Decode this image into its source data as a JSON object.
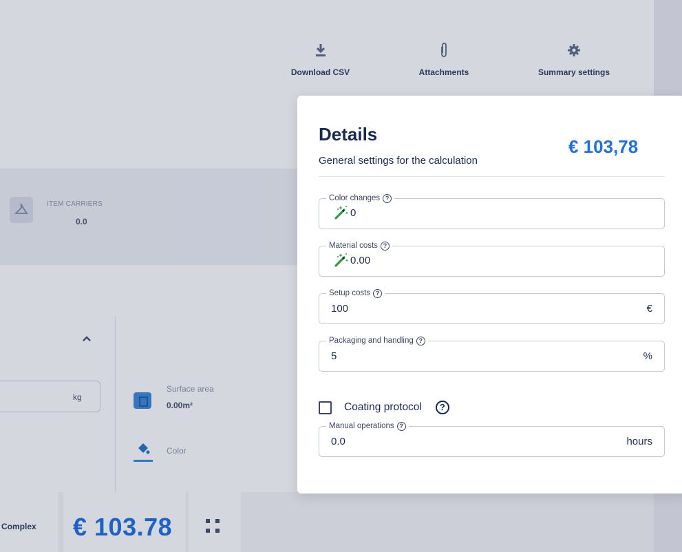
{
  "toolbar": {
    "download_label": "Download CSV",
    "attachments_label": "Attachments",
    "summary_label": "Summary settings"
  },
  "stats": {
    "item_carriers_label": "ITEM CARRIERS",
    "item_carriers_value": "0.0"
  },
  "properties": {
    "weight_unit": "kg",
    "surface_area_label": "Surface area",
    "surface_area_value": "0.00m²",
    "color_label": "Color"
  },
  "footer": {
    "complexity_label": "Complex",
    "total_price": "€ 103.78"
  },
  "details": {
    "title": "Details",
    "subtitle": "General settings for the calculation",
    "price": "€ 103,78",
    "fields": [
      {
        "label": "Color changes",
        "value": "0",
        "unit": "",
        "auto": true
      },
      {
        "label": "Material costs",
        "value": "0.00",
        "unit": "",
        "auto": true
      },
      {
        "label": "Setup costs",
        "value": "100",
        "unit": "€",
        "auto": false
      },
      {
        "label": "Packaging and handling",
        "value": "5",
        "unit": "%",
        "auto": false
      },
      {
        "label": "Manual operations",
        "value": "0.0",
        "unit": "hours",
        "auto": false
      }
    ],
    "coating_protocol_label": "Coating protocol",
    "coating_protocol_checked": false
  },
  "colors": {
    "accent": "#1f6fe0",
    "text_dark": "#1b2b4e",
    "wand_green": "#2e9e3a",
    "overlay": "rgba(30,40,80,0.19)"
  },
  "icons": {
    "download": "download-icon",
    "attachments": "paperclip-icon",
    "summary": "gear-icon",
    "item_carriers": "hanger-icon",
    "surface_area": "surface-area-icon",
    "color": "paint-bucket-icon",
    "expand": "expand-icon",
    "auto_value": "magic-wand-icon",
    "help": "help-circle-icon"
  }
}
